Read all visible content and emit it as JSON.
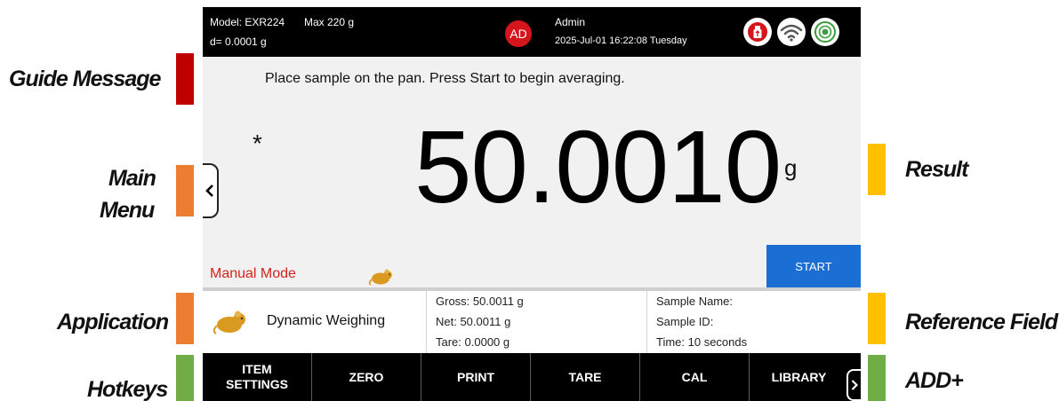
{
  "callouts": {
    "guide_message": "Guide Message",
    "main_menu_line1": "Main",
    "main_menu_line2": "Menu",
    "application": "Application",
    "hotkeys": "Hotkeys",
    "result": "Result",
    "reference_field": "Reference Field",
    "add": "ADD+"
  },
  "callout_colors": {
    "guide_message": "#c00000",
    "main_menu": "#ed7d31",
    "application": "#ed7d31",
    "hotkeys": "#70ad47",
    "result": "#ffc000",
    "reference_field": "#ffc000",
    "add": "#70ad47"
  },
  "status_bar": {
    "model": "Model: EXR224",
    "max": "Max 220 g",
    "readability": "d= 0.0001 g",
    "user_initials": "AD",
    "user_name": "Admin",
    "datetime": "2025-Jul-01 16:22:08 Tuesday",
    "icons": [
      "usb-icon",
      "wifi-icon",
      "level-icon"
    ]
  },
  "guide_message": "Place sample on the pan.  Press Start to begin averaging.",
  "result": {
    "stability_mark": "*",
    "value": "50.0010",
    "unit": "g"
  },
  "mode": {
    "label": "Manual Mode",
    "icon": "rat-icon"
  },
  "start_button": "START",
  "application": {
    "icon": "rat-icon",
    "name": "Dynamic Weighing"
  },
  "weights": {
    "gross": "Gross: 50.0011 g",
    "net": "Net: 50.0011 g",
    "tare": "Tare: 0.0000 g"
  },
  "reference_field": {
    "sample_name": "Sample Name:",
    "sample_id": "Sample ID:",
    "time": "Time: 10 seconds"
  },
  "hotkeys": [
    {
      "line1": "ITEM",
      "line2": "SETTINGS"
    },
    {
      "line1": "ZERO",
      "line2": ""
    },
    {
      "line1": "PRINT",
      "line2": ""
    },
    {
      "line1": "TARE",
      "line2": ""
    },
    {
      "line1": "CAL",
      "line2": ""
    },
    {
      "line1": "LIBRARY",
      "line2": ""
    }
  ],
  "colors": {
    "status_bar_bg": "#000000",
    "avatar_red": "#d4161c",
    "start_blue": "#1b6fd4",
    "mode_red": "#d0241c",
    "rat_gold": "#d99a1f"
  }
}
